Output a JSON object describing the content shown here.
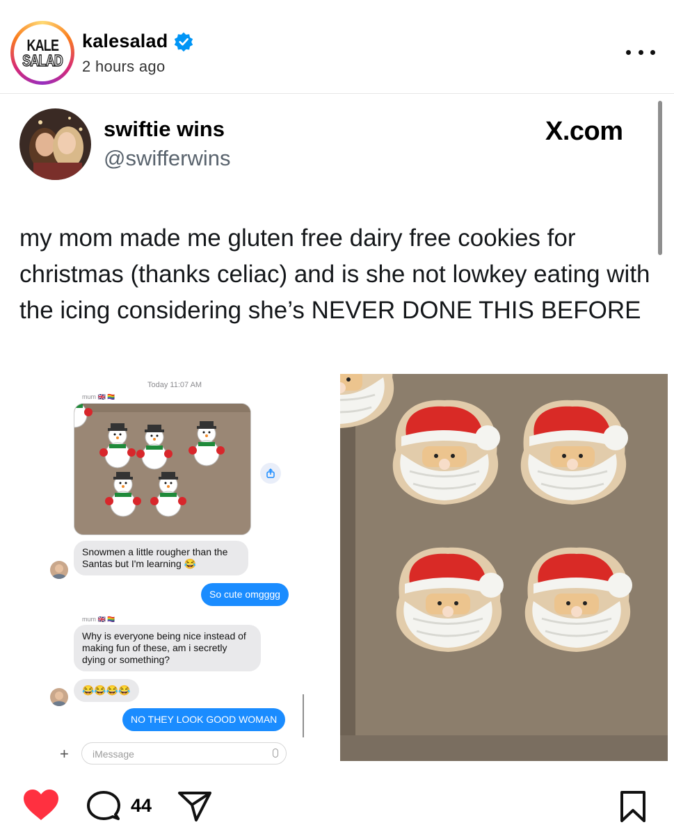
{
  "post": {
    "username": "kalesalad",
    "time": "2 hours ago",
    "avatar_logo_lines": [
      "KALE",
      "SALAD"
    ],
    "verified": true
  },
  "tweet": {
    "name": "swiftie wins",
    "handle": "@swifferwins",
    "source": "X.com",
    "text": "my mom made me gluten free dairy free cookies for christmas (thanks celiac) and is she not lowkey eating with the icing considering she’s NEVER DONE THIS BEFORE"
  },
  "imessage": {
    "timestamp": "Today 11:07 AM",
    "sender_label": "mum 🇬🇧 🏳️‍🌈",
    "messages": [
      {
        "from": "them",
        "text": "Snowmen a little rougher than the Santas but I'm learning 😂"
      },
      {
        "from": "me",
        "text": "So cute omgggg"
      },
      {
        "from": "them",
        "text": "Why is everyone being nice instead of making fun of these, am i secretly dying or something?"
      },
      {
        "from": "them",
        "text": "😂😂😂😂"
      },
      {
        "from": "me",
        "text": "NO THEY LOOK GOOD WOMAN"
      }
    ],
    "input_placeholder": "iMessage"
  },
  "actions": {
    "comment_count": "44",
    "liked": true,
    "like_color": "#ff3040"
  },
  "icons": [
    "verified-badge-icon",
    "more-options-icon",
    "heart-icon",
    "comment-icon",
    "share-icon",
    "bookmark-icon",
    "x-logo-icon"
  ]
}
